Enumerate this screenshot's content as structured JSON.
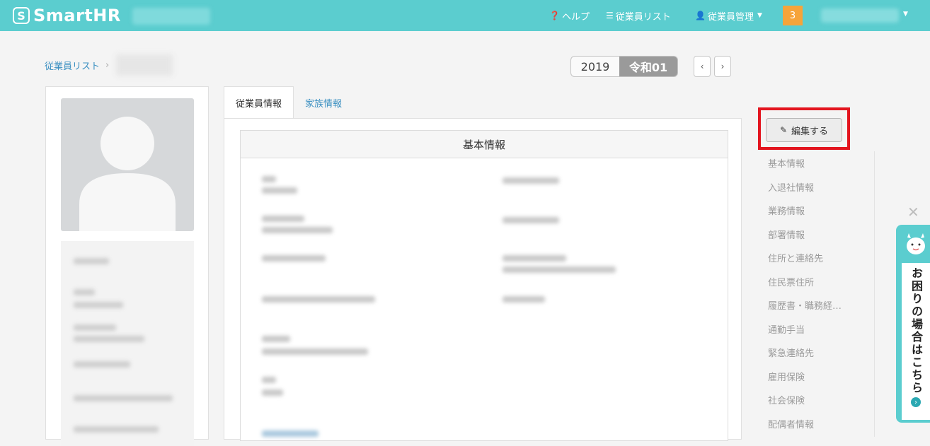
{
  "header": {
    "logo_mark": "S",
    "logo_text": "SmartHR",
    "help_label": "ヘルプ",
    "employee_list_label": "従業員リスト",
    "employee_manage_label": "従業員管理",
    "notification_count": "3"
  },
  "breadcrumb": {
    "root_label": "従業員リスト",
    "separator": "›"
  },
  "year": {
    "western": "2019",
    "japanese": "令和01",
    "prev": "‹",
    "next": "›"
  },
  "tabs": [
    {
      "label": "従業員情報",
      "active": true
    },
    {
      "label": "家族情報",
      "active": false
    }
  ],
  "section": {
    "title": "基本情報"
  },
  "edit_button": {
    "label": "編集する",
    "icon": "pencil-icon"
  },
  "side_nav": [
    "基本情報",
    "入退社情報",
    "業務情報",
    "部署情報",
    "住所と連絡先",
    "住民票住所",
    "履歴書・職務経…",
    "通勤手当",
    "緊急連絡先",
    "雇用保険",
    "社会保険",
    "配偶者情報"
  ],
  "help_widget": {
    "text": "お困りの場合はこちら"
  },
  "colors": {
    "brand": "#5bcdcf",
    "notification": "#f6a43a",
    "highlight": "#e3151f",
    "link": "#3a8fc1"
  }
}
